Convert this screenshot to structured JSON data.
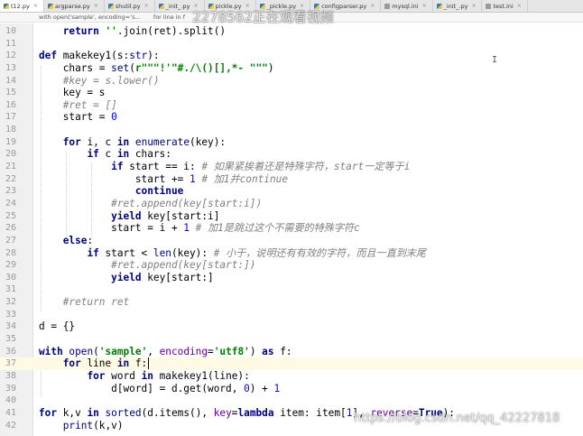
{
  "tabs": [
    {
      "label": "t12.py",
      "icon": "python-file-icon",
      "active": true
    },
    {
      "label": "argparse.py",
      "icon": "python-file-icon"
    },
    {
      "label": "shutil.py",
      "icon": "python-file-icon"
    },
    {
      "label": "_init_.py",
      "icon": "python-file-icon"
    },
    {
      "label": "pickle.py",
      "icon": "python-file-icon"
    },
    {
      "label": "_pickle.py",
      "icon": "python-file-icon"
    },
    {
      "label": "configparser.py",
      "icon": "python-file-icon"
    },
    {
      "label": "mysql.ini",
      "icon": "ini-file-icon"
    },
    {
      "label": "_init_.py",
      "icon": "python-file-icon"
    },
    {
      "label": "test.ini",
      "icon": "ini-file-icon"
    }
  ],
  "breadcrumb": {
    "item1": "with open('sample', encoding=’s...",
    "item2": "for line in f"
  },
  "watermark_top": "2278562正在观看视频",
  "watermark_bottom": "https://blog.csdn.net/qq_42227818",
  "code_lines": [
    {
      "num": "10",
      "tokens": [
        [
          "",
          "    "
        ],
        [
          "kw",
          "return"
        ],
        [
          "",
          " "
        ],
        [
          "str",
          "''"
        ],
        [
          "",
          ".join(ret).split()"
        ]
      ]
    },
    {
      "num": "11",
      "tokens": []
    },
    {
      "num": "12",
      "tokens": [
        [
          "kw",
          "def"
        ],
        [
          "",
          " makekey1(s:"
        ],
        [
          "bi",
          "str"
        ],
        [
          "",
          "):"
        ]
      ]
    },
    {
      "num": "13",
      "tokens": [
        [
          "",
          "    chars = "
        ],
        [
          "bi",
          "set"
        ],
        [
          "",
          "("
        ],
        [
          "str",
          "r\"\"\"!'\"#./\\()[],*- \"\"\""
        ],
        [
          "",
          ")"
        ]
      ]
    },
    {
      "num": "14",
      "tokens": [
        [
          "cmt",
          "    #key = s.lower()"
        ]
      ]
    },
    {
      "num": "15",
      "tokens": [
        [
          "",
          "    key = s"
        ]
      ]
    },
    {
      "num": "16",
      "tokens": [
        [
          "cmt",
          "    #ret = []"
        ]
      ]
    },
    {
      "num": "17",
      "tokens": [
        [
          "",
          "    start = "
        ],
        [
          "num",
          "0"
        ]
      ]
    },
    {
      "num": "18",
      "tokens": []
    },
    {
      "num": "19",
      "tokens": [
        [
          "",
          "    "
        ],
        [
          "kw",
          "for"
        ],
        [
          "",
          " i, c "
        ],
        [
          "kw",
          "in"
        ],
        [
          "",
          " "
        ],
        [
          "bi",
          "enumerate"
        ],
        [
          "",
          "(key):"
        ]
      ]
    },
    {
      "num": "20",
      "tokens": [
        [
          "",
          "        "
        ],
        [
          "kw",
          "if"
        ],
        [
          "",
          " c "
        ],
        [
          "kw",
          "in"
        ],
        [
          "",
          " chars:"
        ]
      ]
    },
    {
      "num": "21",
      "tokens": [
        [
          "",
          "            "
        ],
        [
          "kw",
          "if"
        ],
        [
          "",
          " start == i: "
        ],
        [
          "cmt",
          "# 如果紧挨着还是特殊字符，start一定等于i"
        ]
      ]
    },
    {
      "num": "22",
      "tokens": [
        [
          "",
          "                start += "
        ],
        [
          "num",
          "1"
        ],
        [
          "",
          " "
        ],
        [
          "cmt",
          "# 加1并continue"
        ]
      ]
    },
    {
      "num": "23",
      "tokens": [
        [
          "",
          "                "
        ],
        [
          "kw",
          "continue"
        ]
      ]
    },
    {
      "num": "24",
      "tokens": [
        [
          "cmt",
          "            #ret.append(key[start:i])"
        ]
      ]
    },
    {
      "num": "25",
      "tokens": [
        [
          "",
          "            "
        ],
        [
          "kw",
          "yield"
        ],
        [
          "",
          " key[start:i]"
        ]
      ]
    },
    {
      "num": "26",
      "tokens": [
        [
          "",
          "            start = i + "
        ],
        [
          "num",
          "1"
        ],
        [
          "",
          " "
        ],
        [
          "cmt",
          "# 加1是跳过这个不需要的特殊字符c"
        ]
      ]
    },
    {
      "num": "27",
      "tokens": [
        [
          "",
          "    "
        ],
        [
          "kw",
          "else"
        ],
        [
          "",
          ":"
        ]
      ]
    },
    {
      "num": "28",
      "tokens": [
        [
          "",
          "        "
        ],
        [
          "kw",
          "if"
        ],
        [
          "",
          " start < "
        ],
        [
          "bi",
          "len"
        ],
        [
          "",
          "(key): "
        ],
        [
          "cmt",
          "# 小于，说明还有有效的字符，而且一直到末尾"
        ]
      ]
    },
    {
      "num": "29",
      "tokens": [
        [
          "cmt",
          "            #ret.append(key[start:])"
        ]
      ]
    },
    {
      "num": "30",
      "tokens": [
        [
          "",
          "            "
        ],
        [
          "kw",
          "yield"
        ],
        [
          "",
          " key[start:]"
        ]
      ]
    },
    {
      "num": "31",
      "tokens": []
    },
    {
      "num": "32",
      "tokens": [
        [
          "cmt",
          "    #return ret"
        ]
      ]
    },
    {
      "num": "33",
      "tokens": []
    },
    {
      "num": "34",
      "tokens": [
        [
          "",
          "d = {}"
        ]
      ]
    },
    {
      "num": "35",
      "tokens": []
    },
    {
      "num": "36",
      "tokens": [
        [
          "kw",
          "with"
        ],
        [
          "",
          " "
        ],
        [
          "bi",
          "open"
        ],
        [
          "",
          "("
        ],
        [
          "str",
          "'sample'"
        ],
        [
          "",
          ", "
        ],
        [
          "param",
          "encoding"
        ],
        [
          "",
          "="
        ],
        [
          "str",
          "'utf8'"
        ],
        [
          "",
          ") "
        ],
        [
          "kw",
          "as"
        ],
        [
          "",
          " f:"
        ]
      ]
    },
    {
      "num": "37",
      "current": true,
      "tokens": [
        [
          "",
          "    "
        ],
        [
          "kw",
          "for"
        ],
        [
          "",
          " line "
        ],
        [
          "kw",
          "in"
        ],
        [
          "",
          " f:"
        ],
        [
          "caret",
          ""
        ]
      ]
    },
    {
      "num": "38",
      "tokens": [
        [
          "",
          "        "
        ],
        [
          "kw",
          "for"
        ],
        [
          "",
          " word "
        ],
        [
          "kw",
          "in"
        ],
        [
          "",
          " makekey1(line):"
        ]
      ]
    },
    {
      "num": "39",
      "tokens": [
        [
          "",
          "            d[word] = d.get(word, "
        ],
        [
          "num",
          "0"
        ],
        [
          "",
          ") + "
        ],
        [
          "num",
          "1"
        ]
      ]
    },
    {
      "num": "40",
      "tokens": []
    },
    {
      "num": "41",
      "tokens": [
        [
          "kw",
          "for"
        ],
        [
          "",
          " k,v "
        ],
        [
          "kw",
          "in"
        ],
        [
          "",
          " "
        ],
        [
          "bi",
          "sorted"
        ],
        [
          "",
          "(d.items(), "
        ],
        [
          "param",
          "key"
        ],
        [
          "",
          "="
        ],
        [
          "kw",
          "lambda"
        ],
        [
          "",
          " item: item["
        ],
        [
          "num",
          "1"
        ],
        [
          "",
          "], "
        ],
        [
          "param",
          "reverse"
        ],
        [
          "",
          "="
        ],
        [
          "kw",
          "True"
        ],
        [
          "",
          "):"
        ]
      ]
    },
    {
      "num": "42",
      "tokens": [
        [
          "",
          "    "
        ],
        [
          "bi",
          "print"
        ],
        [
          "",
          "(k,v)"
        ]
      ]
    }
  ]
}
